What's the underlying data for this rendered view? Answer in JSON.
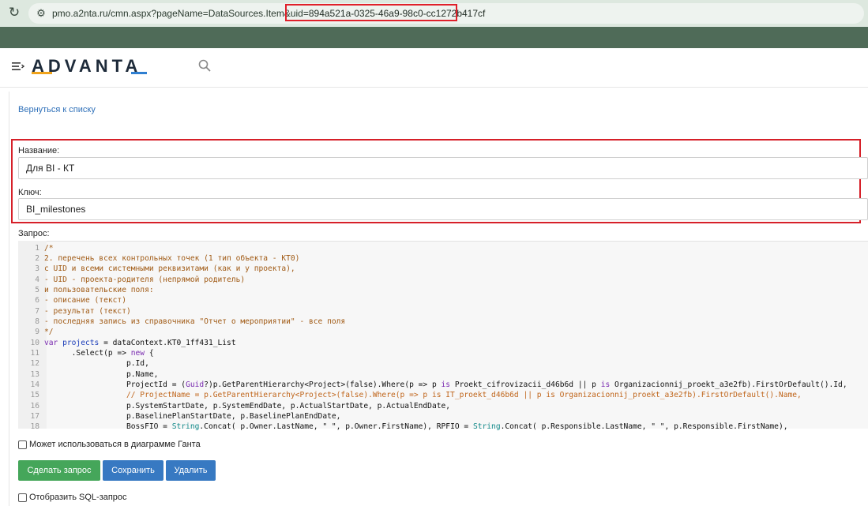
{
  "browser": {
    "reload_glyph": "↻",
    "site_info_glyph": "⚙",
    "url_path": "pmo.a2nta.ru/cmn.aspx?pageName=DataSources.Item&uid",
    "url_uid": "=894a521a-0325-46a9-98c0-cc1272b417cf"
  },
  "header": {
    "logo": "ADVANTA",
    "icons": [
      "menu-icon",
      "search-icon"
    ]
  },
  "page": {
    "back_link": "Вернуться к списку",
    "name_label": "Название:",
    "name_value": "Для BI - КТ",
    "key_label": "Ключ:",
    "key_value": "BI_milestones",
    "query_label": "Запрос:",
    "gantt_label": "Может использоваться в диаграмме Ганта",
    "sql_label": "Отобразить SQL-запрос"
  },
  "buttons": {
    "query": "Сделать запрос",
    "save": "Сохранить",
    "delete": "Удалить"
  },
  "code": {
    "lines": [
      {
        "n": "1",
        "parts": [
          {
            "t": "/*",
            "c": "comment"
          }
        ]
      },
      {
        "n": "2",
        "parts": [
          {
            "t": "2. перечень всех контрольных точек (1 тип объекта - КТ0)",
            "c": "comment"
          }
        ]
      },
      {
        "n": "3",
        "parts": [
          {
            "t": "с UID и всеми системными реквизитами (как и у проекта),",
            "c": "comment"
          }
        ]
      },
      {
        "n": "4",
        "parts": [
          {
            "t": "- UID - проекта-родителя (непрямой родитель)",
            "c": "comment"
          }
        ]
      },
      {
        "n": "5",
        "parts": [
          {
            "t": "и пользовательские поля:",
            "c": "comment"
          }
        ]
      },
      {
        "n": "6",
        "parts": [
          {
            "t": "- описание (текст)",
            "c": "comment"
          }
        ]
      },
      {
        "n": "7",
        "parts": [
          {
            "t": "- результат (текст)",
            "c": "comment"
          }
        ]
      },
      {
        "n": "8",
        "parts": [
          {
            "t": "- последняя запись из справочника \"Отчет о мероприятии\" - все поля",
            "c": "comment"
          }
        ]
      },
      {
        "n": "9",
        "parts": [
          {
            "t": "*/",
            "c": "comment"
          }
        ]
      },
      {
        "n": "10",
        "parts": [
          {
            "t": "var ",
            "c": "kw"
          },
          {
            "t": "projects",
            "c": "var"
          },
          {
            "t": " = dataContext.KT0_1ff431_List",
            "c": "plain"
          }
        ]
      },
      {
        "n": "11",
        "parts": [
          {
            "t": "      .Select(p => ",
            "c": "plain"
          },
          {
            "t": "new",
            "c": "kw"
          },
          {
            "t": " {",
            "c": "plain"
          }
        ]
      },
      {
        "n": "12",
        "parts": [
          {
            "t": "                  p.Id,",
            "c": "plain"
          }
        ]
      },
      {
        "n": "13",
        "parts": [
          {
            "t": "                  p.Name,",
            "c": "plain"
          }
        ]
      },
      {
        "n": "14",
        "parts": [
          {
            "t": "                  ProjectId = (",
            "c": "plain"
          },
          {
            "t": "Guid",
            "c": "kw"
          },
          {
            "t": "?)p.GetParentHierarchy<Project>(false).Where(p => p ",
            "c": "plain"
          },
          {
            "t": "is",
            "c": "kw"
          },
          {
            "t": " Proekt_cifrovizacii_d46b6d || p ",
            "c": "plain"
          },
          {
            "t": "is",
            "c": "kw"
          },
          {
            "t": " Organizacionnij_proekt_a3e2fb).FirstOrDefault().Id,",
            "c": "plain"
          }
        ]
      },
      {
        "n": "15",
        "parts": [
          {
            "t": "                  // ProjectName = p.GetParentHierarchy<Project>(false).Where(p => p is IT_proekt_d46b6d || p is Organizacionnij_proekt_a3e2fb).FirstOrDefault().Name,",
            "c": "italic"
          }
        ]
      },
      {
        "n": "16",
        "parts": [
          {
            "t": "                  p.SystemStartDate, p.SystemEndDate, p.ActualStartDate, p.ActualEndDate,",
            "c": "plain"
          }
        ]
      },
      {
        "n": "17",
        "parts": [
          {
            "t": "                  p.BaselinePlanStartDate, p.BaselinePlanEndDate,",
            "c": "plain"
          }
        ]
      },
      {
        "n": "18",
        "parts": [
          {
            "t": "                  BossFIO = ",
            "c": "plain"
          },
          {
            "t": "String",
            "c": "type"
          },
          {
            "t": ".Concat( p.Owner.LastName, \" \", p.Owner.FirstName), RPFIO = ",
            "c": "plain"
          },
          {
            "t": "String",
            "c": "type"
          },
          {
            "t": ".Concat( p.Responsible.LastName, \" \", p.Responsible.FirstName),",
            "c": "plain"
          }
        ]
      }
    ]
  }
}
